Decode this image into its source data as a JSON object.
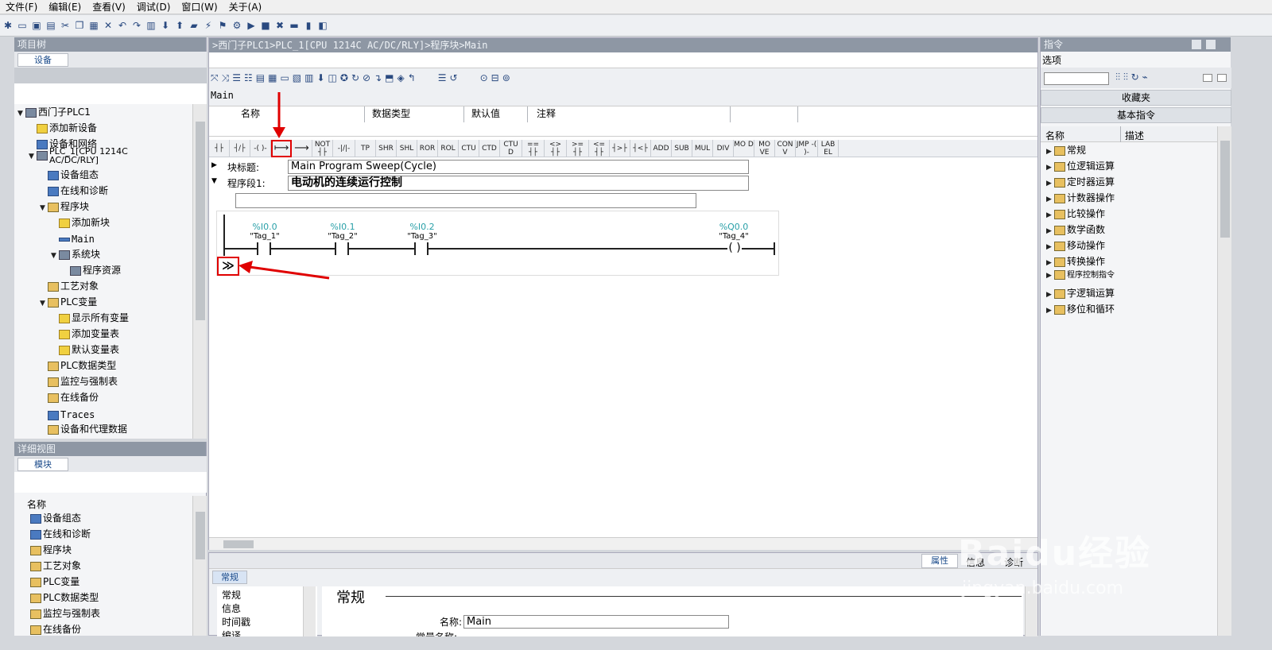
{
  "menu": [
    "文件(F)",
    "编辑(E)",
    "查看(V)",
    "调试(D)",
    "窗口(W)",
    "关于(A)"
  ],
  "project_tree": {
    "title": "项目树",
    "tab": "设备",
    "items": [
      {
        "label": "西门子PLC1"
      },
      {
        "label": "添加新设备"
      },
      {
        "label": "设备和网络"
      },
      {
        "label": "PLC_1[CPU 1214C"
      },
      {
        "label": "AC/DC/RLY]"
      },
      {
        "label": "设备组态"
      },
      {
        "label": "在线和诊断"
      },
      {
        "label": "程序块"
      },
      {
        "label": "添加新块"
      },
      {
        "label": "Main"
      },
      {
        "label": "系统块"
      },
      {
        "label": "程序资源"
      },
      {
        "label": "工艺对象"
      },
      {
        "label": "PLC变量"
      },
      {
        "label": "显示所有变量"
      },
      {
        "label": "添加变量表"
      },
      {
        "label": "默认变量表"
      },
      {
        "label": "PLC数据类型"
      },
      {
        "label": "监控与强制表"
      },
      {
        "label": "在线备份"
      },
      {
        "label": "Traces"
      },
      {
        "label": "设备和代理数据"
      }
    ]
  },
  "detail_view": {
    "title": "详细视图",
    "tab": "模块",
    "column": "名称",
    "items": [
      "设备组态",
      "在线和诊断",
      "程序块",
      "工艺对象",
      "PLC变量",
      "PLC数据类型",
      "监控与强制表",
      "在线备份"
    ]
  },
  "editor": {
    "breadcrumb": ">西门子PLC1>PLC_1[CPU 1214C AC/DC/RLY]>程序块>Main",
    "block_name": "Main",
    "iface_cols": [
      "名称",
      "数据类型",
      "默认值",
      "注释"
    ],
    "ladder_buttons": [
      "┤├",
      "┤/├",
      "-( )-",
      "⟼",
      "⟶",
      "NOT ┤├",
      "-|/|-",
      "TP",
      "SHR",
      "SHL",
      "ROR",
      "ROL",
      "CTU",
      "CTD",
      "CTU D",
      "== ┤├",
      "<> ┤├",
      ">= ┤├",
      "<= ┤├",
      "┤>├",
      "┤<├",
      "ADD",
      "SUB",
      "MUL",
      "DIV",
      "MO D",
      "MO VE",
      "CON V",
      "JMP -( )-",
      "LAB EL"
    ],
    "block_title_label": "块标题:",
    "block_title_value": "Main Program Sweep(Cycle)",
    "network_label": "程序段1:",
    "network_value": "电动机的连续运行控制",
    "contacts": [
      {
        "addr": "%I0.0",
        "tag": "\"Tag_1\""
      },
      {
        "addr": "%I0.1",
        "tag": "\"Tag_2\""
      },
      {
        "addr": "%I0.2",
        "tag": "\"Tag_3\""
      }
    ],
    "coil": {
      "addr": "%Q0.0",
      "tag": "\"Tag_4\""
    }
  },
  "properties": {
    "tabs_right": [
      "属性",
      "信息",
      "诊断"
    ],
    "tab": "常规",
    "nav": [
      "常规",
      "信息",
      "时间戳",
      "编译"
    ],
    "section": "常规",
    "name_label": "名称:",
    "name_value": "Main",
    "type_label": "常量名称:"
  },
  "instructions": {
    "title": "指令",
    "options": "选项",
    "favorites": "收藏夹",
    "basic": "基本指令",
    "col_name": "名称",
    "col_desc": "描述",
    "items": [
      "常规",
      "位逻辑运算",
      "定时器运算",
      "计数器操作",
      "比较操作",
      "数学函数",
      "移动操作",
      "转换操作",
      "程序控制指令",
      "字逻辑运算",
      "移位和循环"
    ]
  },
  "watermark": {
    "brand": "Baidu经验",
    "url": "jingyan.baidu.com"
  },
  "colors": {
    "accent": "#1a4a8a",
    "highlight": "#e00000",
    "panel_header": "#8e97a4",
    "tag_address": "#2aa0a8"
  }
}
